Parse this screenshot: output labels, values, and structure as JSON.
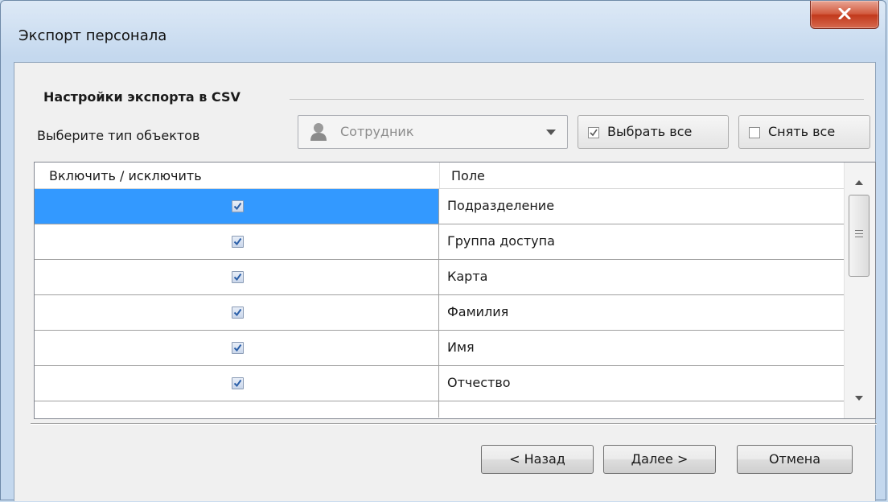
{
  "window": {
    "title": "Экспорт персонала"
  },
  "settings": {
    "group_title": "Настройки экспорта в CSV",
    "object_type_label": "Выберите тип объектов",
    "object_type_value": "Сотрудник",
    "select_all_label": "Выбрать все",
    "clear_all_label": "Снять все"
  },
  "table": {
    "columns": [
      "Включить / исключить",
      "Поле"
    ],
    "rows": [
      {
        "included": true,
        "field": "Подразделение",
        "selected": true
      },
      {
        "included": true,
        "field": "Группа доступа",
        "selected": false
      },
      {
        "included": true,
        "field": "Карта",
        "selected": false
      },
      {
        "included": true,
        "field": "Фамилия",
        "selected": false
      },
      {
        "included": true,
        "field": "Имя",
        "selected": false
      },
      {
        "included": true,
        "field": "Отчество",
        "selected": false
      }
    ]
  },
  "buttons": {
    "back": "< Назад",
    "next": "Далее >",
    "cancel": "Отмена"
  },
  "colors": {
    "selection": "#3399ff",
    "close_button": "#c8432a",
    "frame": "#c4d8ee"
  },
  "icons": [
    "close-icon",
    "person-icon",
    "dropdown-arrow-icon",
    "checkmark-icon",
    "scroll-up-icon",
    "scroll-down-icon"
  ]
}
